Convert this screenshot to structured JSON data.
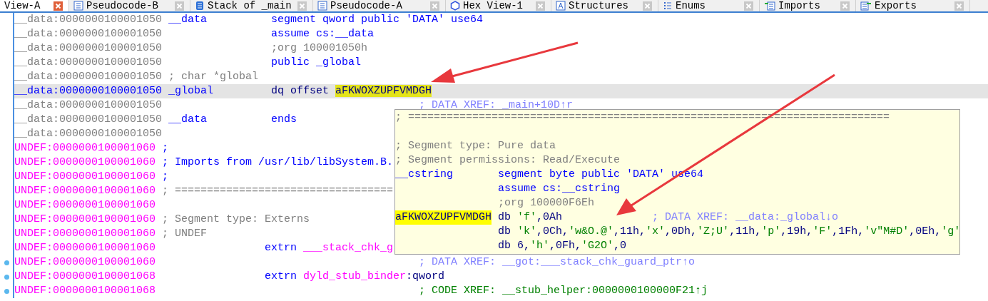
{
  "tabs": [
    {
      "label": "View-A",
      "selected": true
    },
    {
      "label": "Pseudocode-B",
      "selected": false
    },
    {
      "label": "Stack of _main",
      "selected": false
    },
    {
      "label": "Pseudocode-A",
      "selected": false
    },
    {
      "label": "Hex View-1",
      "selected": false
    },
    {
      "label": "Structures",
      "selected": false
    },
    {
      "label": "Enums",
      "selected": false
    },
    {
      "label": "Imports",
      "selected": false
    },
    {
      "label": "Exports",
      "selected": false
    }
  ],
  "lines": [
    {
      "address": "__data:0000000100001050",
      "kind": "data",
      "selected": false,
      "breakpoint": false,
      "label": "__data",
      "instruction": [
        {
          "text": "segment qword public 'DATA' use64",
          "kind": "keyword"
        }
      ]
    },
    {
      "address": "__data:0000000100001050",
      "kind": "data",
      "selected": false,
      "breakpoint": false,
      "instruction": [
        {
          "text": "assume cs:__data",
          "kind": "keyword"
        }
      ]
    },
    {
      "address": "__data:0000000100001050",
      "kind": "data",
      "selected": false,
      "breakpoint": false,
      "instruction": [
        {
          "text": ";org 100001050h",
          "kind": "comment"
        }
      ]
    },
    {
      "address": "__data:0000000100001050",
      "kind": "data",
      "selected": false,
      "breakpoint": false,
      "instruction": [
        {
          "text": "public _global",
          "kind": "keyword"
        }
      ]
    },
    {
      "address": "__data:0000000100001050",
      "kind": "data",
      "selected": false,
      "breakpoint": false,
      "comment": {
        "text": "; char *global",
        "kind": "grey"
      }
    },
    {
      "address": "__data:0000000100001050",
      "kind": "data",
      "selected": true,
      "breakpoint": false,
      "label": "_global",
      "instruction": [
        {
          "text": "dq offset ",
          "kind": "plain"
        },
        {
          "text": "aFKWOXZUPFVMDGH",
          "kind": "highlight"
        }
      ]
    },
    {
      "address": "__data:0000000100001050",
      "kind": "data",
      "selected": false,
      "breakpoint": false,
      "xref": {
        "text": "; DATA XREF: _main+10D↑r",
        "kind": "data"
      }
    },
    {
      "address": "__data:0000000100001050",
      "kind": "data",
      "selected": false,
      "breakpoint": false,
      "label": "__data",
      "instruction": [
        {
          "text": "ends",
          "kind": "keyword"
        }
      ]
    },
    {
      "address": "__data:0000000100001050",
      "kind": "data",
      "selected": false,
      "breakpoint": false
    },
    {
      "address": "UNDEF:0000000100001060",
      "kind": "undef",
      "selected": false,
      "breakpoint": false,
      "comment": {
        "text": ";",
        "kind": "blue"
      }
    },
    {
      "address": "UNDEF:0000000100001060",
      "kind": "undef",
      "selected": false,
      "breakpoint": false,
      "comment": {
        "text": "; Imports from /usr/lib/libSystem.B.",
        "kind": "blue"
      }
    },
    {
      "address": "UNDEF:0000000100001060",
      "kind": "undef",
      "selected": false,
      "breakpoint": false,
      "comment": {
        "text": ";",
        "kind": "blue"
      }
    },
    {
      "address": "UNDEF:0000000100001060",
      "kind": "undef",
      "selected": false,
      "breakpoint": false,
      "comment": {
        "text": "; ==================================",
        "kind": "grey"
      }
    },
    {
      "address": "UNDEF:0000000100001060",
      "kind": "undef",
      "selected": false,
      "breakpoint": false
    },
    {
      "address": "UNDEF:0000000100001060",
      "kind": "undef",
      "selected": false,
      "breakpoint": false,
      "comment": {
        "text": "; Segment type: Externs",
        "kind": "grey"
      }
    },
    {
      "address": "UNDEF:0000000100001060",
      "kind": "undef",
      "selected": false,
      "breakpoint": false,
      "comment": {
        "text": "; UNDEF",
        "kind": "grey"
      }
    },
    {
      "address": "UNDEF:0000000100001060",
      "kind": "undef",
      "selected": false,
      "breakpoint": false,
      "extrn": [
        {
          "text": "extrn ",
          "kind": "keyword"
        },
        {
          "text": "___stack_chk_g",
          "kind": "import"
        }
      ]
    },
    {
      "address": "UNDEF:0000000100001060",
      "kind": "undef",
      "selected": false,
      "breakpoint": true,
      "xref": {
        "text": "; DATA XREF: __got:___stack_chk_guard_ptr↑o",
        "kind": "data"
      }
    },
    {
      "address": "UNDEF:0000000100001068",
      "kind": "undef",
      "selected": false,
      "breakpoint": true,
      "extrn": [
        {
          "text": "extrn ",
          "kind": "keyword"
        },
        {
          "text": "dyld_stub_binder",
          "kind": "import"
        },
        {
          "text": ":qword",
          "kind": "plain"
        }
      ]
    },
    {
      "address": "UNDEF:0000000100001068",
      "kind": "undef",
      "selected": false,
      "breakpoint": true,
      "xref": {
        "text": "; CODE XREF: __stub_helper:0000000100000F21↑j",
        "kind": "code"
      }
    }
  ],
  "tooltip": {
    "lines": [
      {
        "kind": "text",
        "comment": {
          "text": "; ===========================================================================",
          "kind": "grey"
        }
      },
      {
        "kind": "blank"
      },
      {
        "kind": "text",
        "comment": {
          "text": "; Segment type: Pure data",
          "kind": "grey"
        }
      },
      {
        "kind": "text",
        "comment": {
          "text": "; Segment permissions: Read/Execute",
          "kind": "grey"
        }
      },
      {
        "kind": "text",
        "label": "__cstring",
        "label_highlighted": false,
        "instruction": [
          {
            "text": "segment byte public 'DATA' use64",
            "kind": "keyword"
          }
        ]
      },
      {
        "kind": "text",
        "instruction": [
          {
            "text": "assume cs:__cstring",
            "kind": "keyword"
          }
        ]
      },
      {
        "kind": "text",
        "instruction": [
          {
            "text": ";org 100000F6Eh",
            "kind": "comment"
          }
        ]
      },
      {
        "kind": "text",
        "label": "aFKWOXZUPFVMDGH",
        "label_highlighted": true,
        "instruction": [
          {
            "text": "db ",
            "kind": "plain"
          },
          {
            "text": "'f'",
            "kind": "string"
          },
          {
            "text": ",0Ah",
            "kind": "plain"
          }
        ],
        "xref": {
          "text": "; DATA XREF: __data:_global↓o",
          "kind": "data"
        }
      },
      {
        "kind": "text",
        "instruction": [
          {
            "text": "db ",
            "kind": "plain"
          },
          {
            "text": "'k'",
            "kind": "string"
          },
          {
            "text": ",0Ch,",
            "kind": "plain"
          },
          {
            "text": "'w&O.@'",
            "kind": "string"
          },
          {
            "text": ",11h,",
            "kind": "plain"
          },
          {
            "text": "'x'",
            "kind": "string"
          },
          {
            "text": ",0Dh,",
            "kind": "plain"
          },
          {
            "text": "'Z;U'",
            "kind": "string"
          },
          {
            "text": ",11h,",
            "kind": "plain"
          },
          {
            "text": "'p'",
            "kind": "string"
          },
          {
            "text": ",19h,",
            "kind": "plain"
          },
          {
            "text": "'F'",
            "kind": "string"
          },
          {
            "text": ",1Fh,",
            "kind": "plain"
          },
          {
            "text": "'v\"M#D'",
            "kind": "string"
          },
          {
            "text": ",0Eh,",
            "kind": "plain"
          },
          {
            "text": "'g'",
            "kind": "string"
          }
        ]
      },
      {
        "kind": "text",
        "instruction": [
          {
            "text": "db 6,",
            "kind": "plain"
          },
          {
            "text": "'h'",
            "kind": "string"
          },
          {
            "text": ",0Fh,",
            "kind": "plain"
          },
          {
            "text": "'G2O'",
            "kind": "string"
          },
          {
            "text": ",0",
            "kind": "plain"
          }
        ]
      }
    ]
  }
}
